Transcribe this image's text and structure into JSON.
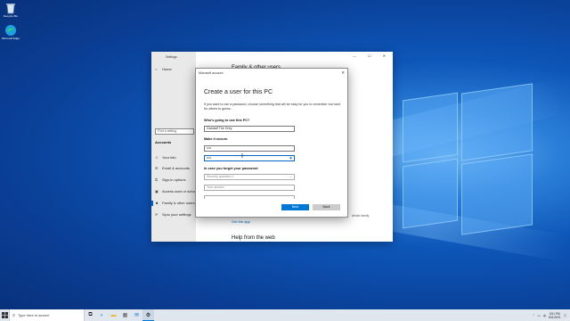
{
  "desktop": {
    "icons": [
      {
        "name": "recycle-bin-icon",
        "label": "Recycle Bin"
      },
      {
        "name": "edge-icon",
        "label": "Microsoft Edge"
      }
    ]
  },
  "settings": {
    "title": "Settings",
    "home": "Home",
    "find_placeholder": "Find a setting",
    "section": "Accounts",
    "nav": [
      "Your info",
      "Email & accounts",
      "Sign-in options",
      "Access work or school",
      "Family & other users",
      "Sync your settings"
    ],
    "main_title": "Family & other users",
    "link": "Get the app",
    "help": "Help from the web",
    "extra_text": "whole family"
  },
  "dialog": {
    "app": "Microsoft account",
    "close": "✕",
    "title": "Create a user for this PC",
    "description": "If you want to use a password, choose something that will be easy for you to remember but hard for others to guess.",
    "who_label": "Who's going to use this PC?",
    "username": "Gandalf The Grey",
    "secure_label": "Make it secure.",
    "password": "••••",
    "confirm": "••••",
    "forget_label": "In case you forget your password",
    "question_placeholder": "Security question 1",
    "answer_placeholder": "Your answer",
    "next": "Next",
    "back": "Back"
  },
  "taskbar": {
    "search_placeholder": "Type here to search",
    "time": "3:51 PM",
    "date": "3/11/2021"
  },
  "colors": {
    "accent": "#0078d4",
    "desktop": "#0a4aa8"
  }
}
